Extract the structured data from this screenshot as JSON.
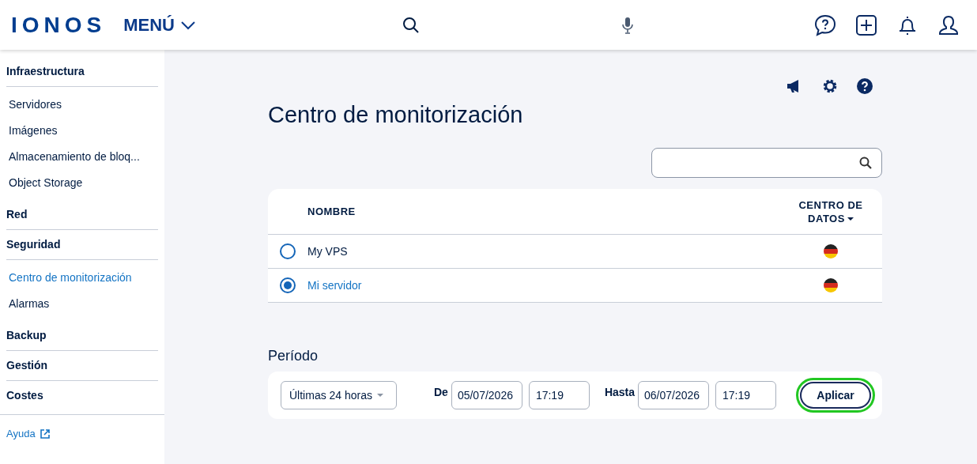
{
  "header": {
    "logo": "IONOS",
    "menu": "MENÚ"
  },
  "sidebar": {
    "groups": [
      {
        "heading": "Infraestructura",
        "items": [
          {
            "label": "Servidores",
            "selected": false
          },
          {
            "label": "Imágenes",
            "selected": false
          },
          {
            "label": "Almacenamiento de bloq...",
            "selected": false
          },
          {
            "label": "Object Storage",
            "selected": false
          }
        ]
      },
      {
        "heading": "Red"
      },
      {
        "heading": "Seguridad",
        "items": [
          {
            "label": "Centro de monitorización",
            "selected": true
          },
          {
            "label": "Alarmas",
            "selected": false
          }
        ]
      },
      {
        "heading": "Backup"
      },
      {
        "heading": "Gestión"
      },
      {
        "heading": "Costes"
      }
    ],
    "help_link": "Ayuda"
  },
  "page": {
    "title": "Centro de monitorización",
    "table": {
      "columns": [
        "NOMBRE",
        "CENTRO DE DATOS"
      ],
      "rows": [
        {
          "name": "My VPS",
          "selected": false
        },
        {
          "name": "Mi servidor",
          "selected": true
        }
      ]
    },
    "period": {
      "label": "Período",
      "preset": "Últimas 24 horas",
      "from_label": "De",
      "from_date": "05/07/2026",
      "from_time": "17:19",
      "to_label": "Hasta",
      "to_date": "06/07/2026",
      "to_time": "17:19",
      "apply": {
        "label": "Aplicar",
        "highlighted": true
      }
    }
  }
}
